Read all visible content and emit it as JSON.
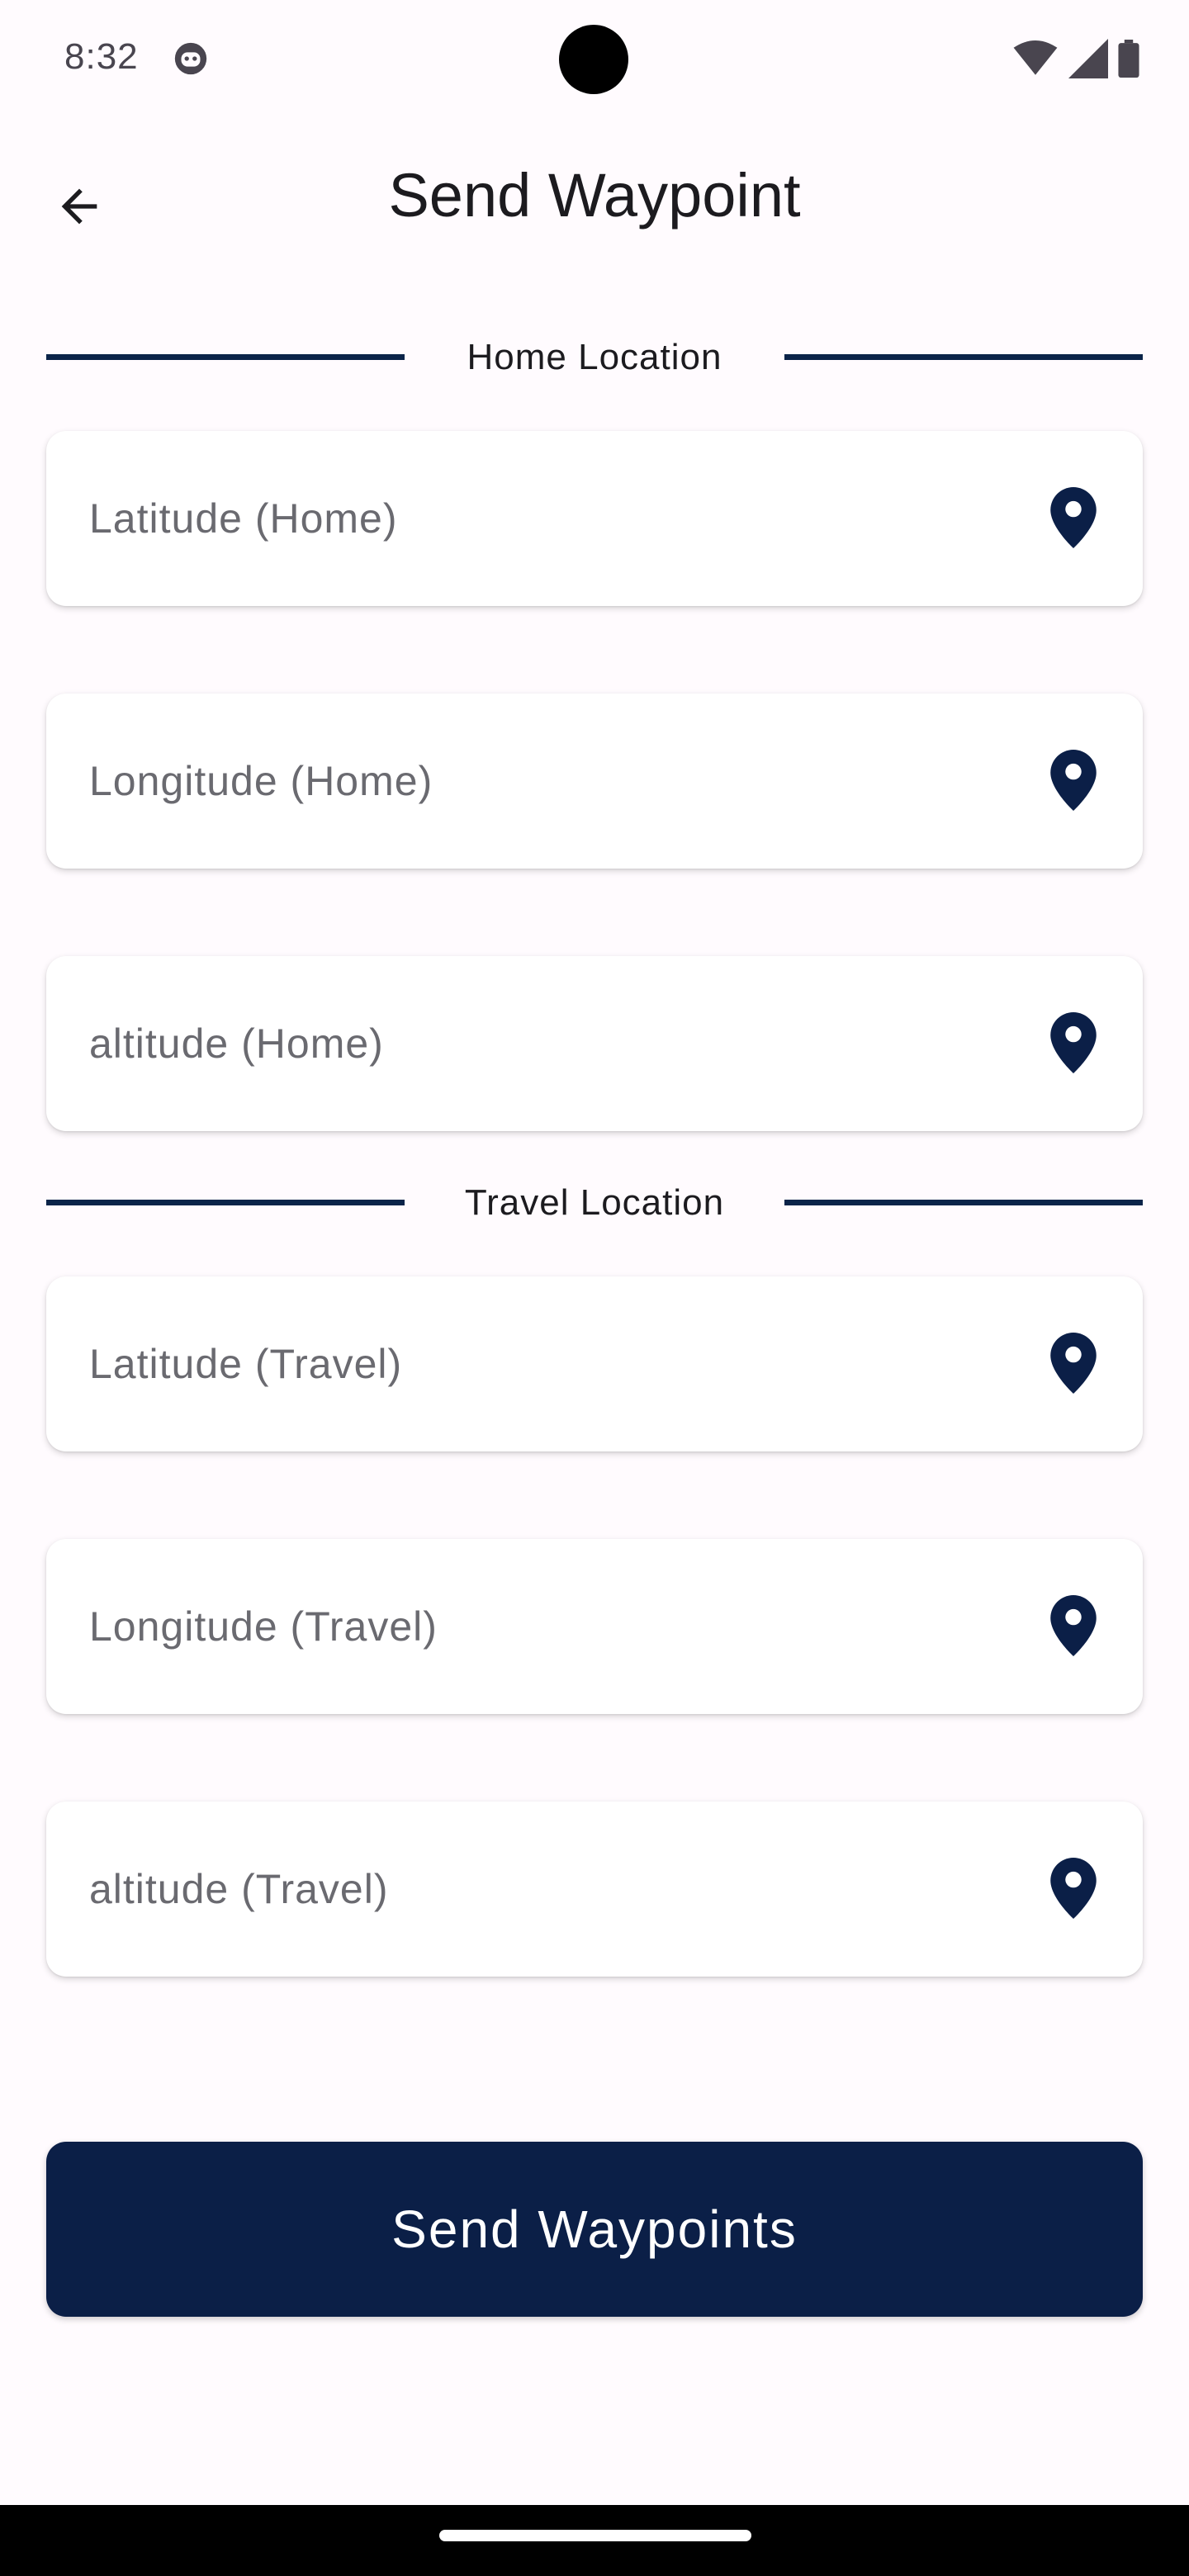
{
  "status_bar": {
    "time": "8:32",
    "icons": [
      "face-icon",
      "wifi-icon",
      "signal-icon",
      "battery-icon"
    ]
  },
  "app_bar": {
    "back_icon": "arrow-back-icon",
    "title": "Send Waypoint"
  },
  "sections": {
    "home": {
      "label": "Home Location"
    },
    "travel": {
      "label": "Travel Location"
    }
  },
  "fields": {
    "lat_home": {
      "placeholder": "Latitude (Home)",
      "value": ""
    },
    "lon_home": {
      "placeholder": "Longitude (Home)",
      "value": ""
    },
    "alt_home": {
      "placeholder": "altitude (Home)",
      "value": ""
    },
    "lat_travel": {
      "placeholder": "Latitude (Travel)",
      "value": ""
    },
    "lon_travel": {
      "placeholder": "Longitude (Travel)",
      "value": ""
    },
    "alt_travel": {
      "placeholder": "altitude (Travel)",
      "value": ""
    },
    "icon": "location-pin-icon"
  },
  "send_button": {
    "label": "Send Waypoints"
  },
  "colors": {
    "primary": "#0b1f47",
    "divider": "#0b2449",
    "background": "#fffbfe",
    "card": "#ffffff"
  }
}
